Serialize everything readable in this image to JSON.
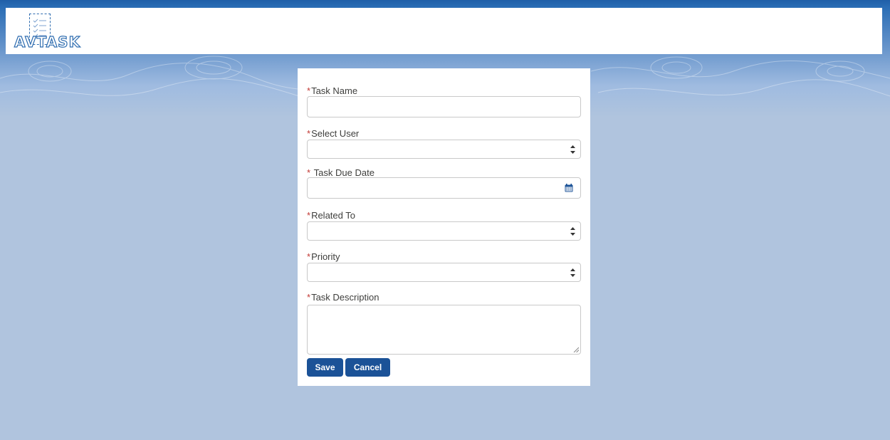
{
  "header": {
    "logo_text": "AVTASK"
  },
  "form": {
    "fields": [
      {
        "label": "Task Name",
        "required_mark": "*",
        "type": "text",
        "value": ""
      },
      {
        "label": "Select User",
        "required_mark": "*",
        "type": "select",
        "value": ""
      },
      {
        "label": "Task Due Date",
        "required_mark": "* ",
        "type": "date",
        "value": ""
      },
      {
        "label": "Related To",
        "required_mark": "*",
        "type": "select",
        "value": ""
      },
      {
        "label": "Priority",
        "required_mark": "*",
        "type": "select",
        "value": ""
      },
      {
        "label": "Task Description",
        "required_mark": "*",
        "type": "textarea",
        "value": ""
      }
    ],
    "save_label": "Save",
    "cancel_label": "Cancel"
  },
  "icons": {
    "select_arrows": "updown-arrow-icon",
    "date_picker": "calendar-icon",
    "resize": "resize-handle-icon"
  },
  "colors": {
    "primary_button": "#1b5297",
    "required_mark": "#c23934",
    "page_background": "#b0c4de",
    "header_band": "#1f5fa8"
  }
}
